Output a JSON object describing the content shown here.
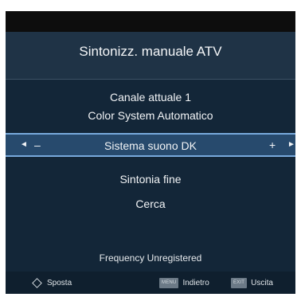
{
  "title": "Sintonizz. manuale ATV",
  "menu": {
    "canale": "Canale attuale 1",
    "color": "Color System Automatico",
    "suono": {
      "label": "Sistema suono DK",
      "left_arrow": "◄",
      "minus": "–",
      "plus": "+",
      "right_arrow": "►"
    },
    "sintonia": "Sintonia fine",
    "cerca": "Cerca"
  },
  "status": "Frequency Unregistered",
  "footer": {
    "move_label": "Sposta",
    "back_key": "MENU",
    "back_label": "Indietro",
    "exit_key": "EXIT",
    "exit_label": "Uscita"
  },
  "colors": {
    "panel": "#132638",
    "header": "#1f3346",
    "highlight": "#274a6d",
    "highlight_border": "#78a9dc",
    "footer": "#0f1f2e"
  }
}
